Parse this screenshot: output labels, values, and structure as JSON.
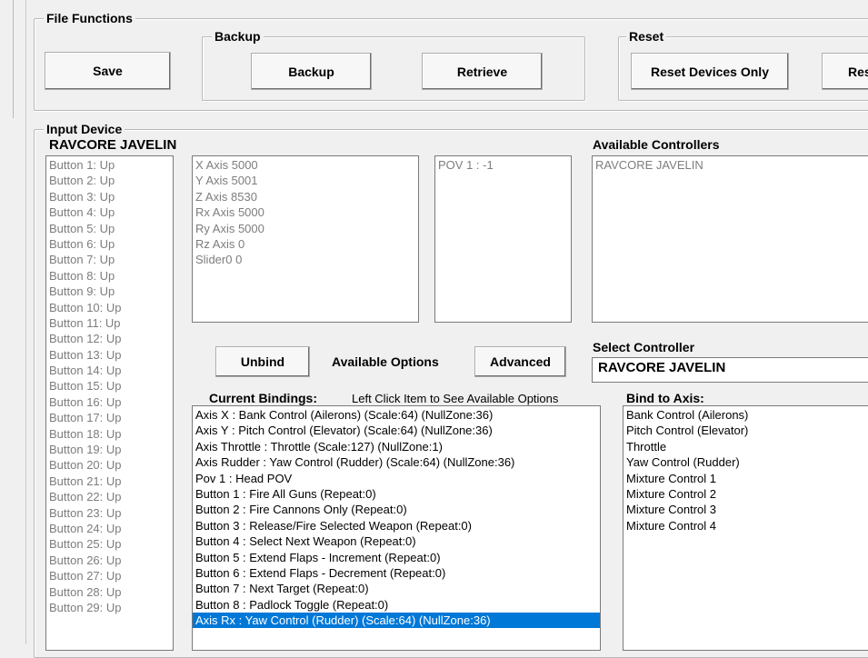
{
  "file_functions": {
    "title": "File Functions",
    "save_label": "Save",
    "backup": {
      "title": "Backup",
      "backup_label": "Backup",
      "retrieve_label": "Retrieve"
    },
    "reset": {
      "title": "Reset",
      "reset_devices_label": "Reset Devices Only",
      "reset_all_label": "Reset"
    }
  },
  "input_device": {
    "title": "Input Device",
    "device_name": "RAVCORE JAVELIN",
    "buttons": [
      "Button 1: Up",
      "Button 2: Up",
      "Button 3: Up",
      "Button 4: Up",
      "Button 5: Up",
      "Button 6: Up",
      "Button 7: Up",
      "Button 8: Up",
      "Button 9: Up",
      "Button 10: Up",
      "Button 11: Up",
      "Button 12: Up",
      "Button 13: Up",
      "Button 14: Up",
      "Button 15: Up",
      "Button 16: Up",
      "Button 17: Up",
      "Button 18: Up",
      "Button 19: Up",
      "Button 20: Up",
      "Button 21: Up",
      "Button 22: Up",
      "Button 23: Up",
      "Button 24: Up",
      "Button 25: Up",
      "Button 26: Up",
      "Button 27: Up",
      "Button 28: Up",
      "Button 29: Up"
    ],
    "axes": [
      "X Axis 5000",
      "Y Axis 5001",
      "Z Axis 8530",
      "Rx Axis 5000",
      "Ry Axis 5000",
      "Rz Axis 0",
      "Slider0 0"
    ],
    "povs": [
      "POV 1 : -1"
    ]
  },
  "available_controllers": {
    "title": "Available Controllers",
    "items": [
      "RAVCORE JAVELIN"
    ]
  },
  "options": {
    "unbind_label": "Unbind",
    "available_options_label": "Available Options",
    "advanced_label": "Advanced"
  },
  "select_controller": {
    "title": "Select Controller",
    "value": "RAVCORE JAVELIN"
  },
  "current_bindings": {
    "title": "Current Bindings:",
    "hint": "Left Click Item to See Available Options",
    "items": [
      "Axis X : Bank Control (Ailerons)  (Scale:64)  (NullZone:36)",
      "Axis Y : Pitch Control (Elevator)  (Scale:64)  (NullZone:36)",
      "Axis Throttle : Throttle  (Scale:127)  (NullZone:1)",
      "Axis Rudder : Yaw Control (Rudder)  (Scale:64)  (NullZone:36)",
      "Pov 1 : Head POV",
      "Button 1 : Fire All Guns  (Repeat:0)",
      "Button 2 : Fire Cannons Only  (Repeat:0)",
      "Button 3 : Release/Fire Selected Weapon  (Repeat:0)",
      "Button 4 : Select Next Weapon  (Repeat:0)",
      "Button 5 : Extend Flaps - Increment  (Repeat:0)",
      "Button 6 : Extend Flaps - Decrement  (Repeat:0)",
      "Button 7 : Next Target  (Repeat:0)",
      "Button 8 : Padlock Toggle  (Repeat:0)",
      "Axis Rx : Yaw Control (Rudder)  (Scale:64)  (NullZone:36)"
    ],
    "selected_index": 13
  },
  "bind_to_axis": {
    "title": "Bind to Axis:",
    "items": [
      "Bank Control (Ailerons)",
      "Pitch Control  (Elevator)",
      "Throttle",
      "Yaw Control (Rudder)",
      "Mixture Control 1",
      "Mixture Control 2",
      "Mixture Control 3",
      "Mixture Control 4"
    ]
  },
  "colors": {
    "selection": "#0078d7",
    "background": "#f0f0f0"
  }
}
